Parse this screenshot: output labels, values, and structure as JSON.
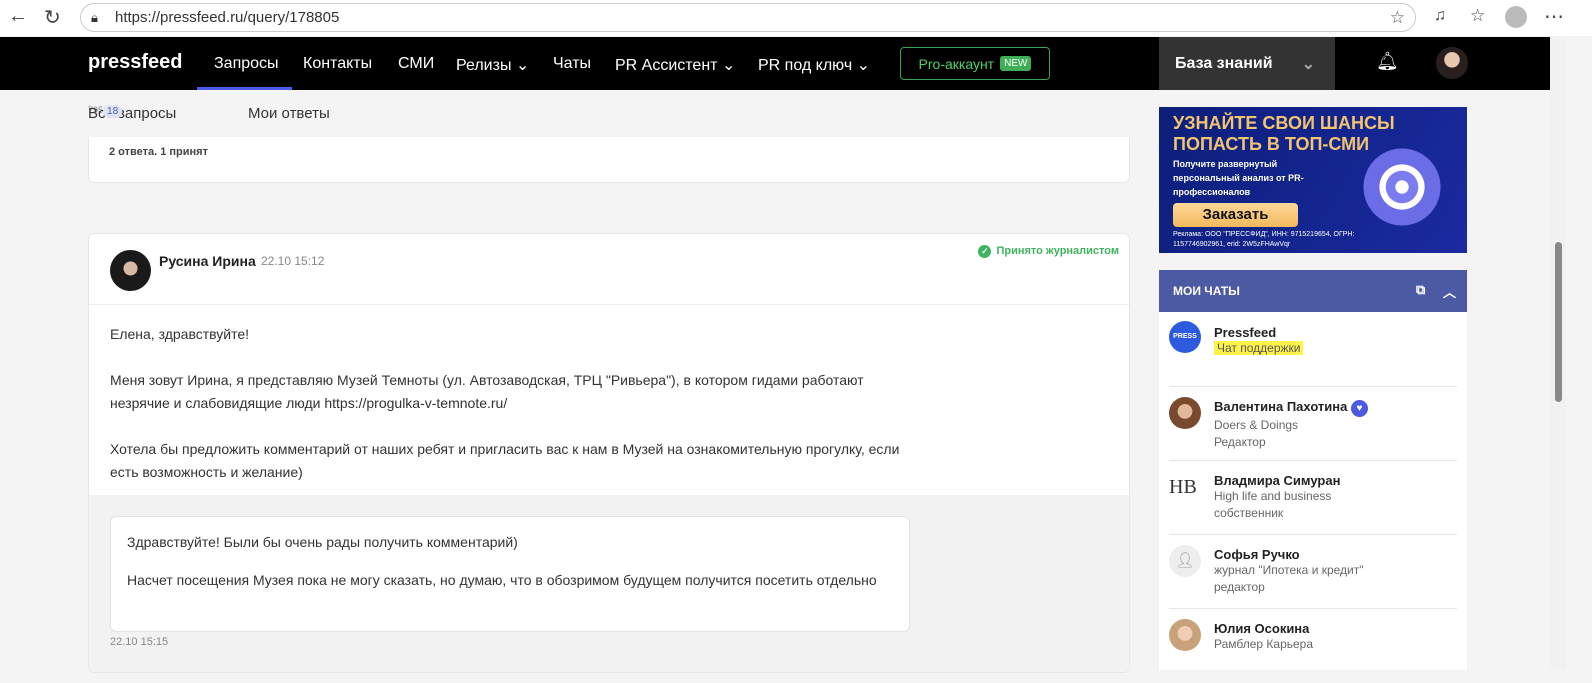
{
  "browser": {
    "url": "https://pressfeed.ru/query/178805"
  },
  "nav": {
    "logo": "pressfeed",
    "items": [
      "Запросы",
      "Контакты",
      "СМИ",
      "Релизы",
      "Чаты",
      "PR Ассистент",
      "PR под ключ"
    ],
    "pro": "Pro-аккаунт",
    "new_badge": "NEW",
    "knowledge": "База знаний"
  },
  "subtabs": {
    "all": "Все запросы",
    "all_count": "795",
    "new_count": "18",
    "mine": "Мои ответы"
  },
  "prev_card": {
    "status": "2 ответа. 1 принят"
  },
  "answer": {
    "author": "Русина Ирина",
    "time": "22.10 15:12",
    "status": "Принято журналистом",
    "paragraphs": [
      "Елена, здравствуйте!",
      "Меня зовут Ирина, я представляю Музей Темноты (ул. Автозаводская, ТРЦ \"Ривьера\"), в котором гидами работают незрячие и слабовидящие люди https://progulka-v-temnote.ru/",
      "Хотела бы предложить комментарий от наших ребят и пригласить вас к нам в Музей на ознакомительную прогулку, если есть возможность и желание)"
    ],
    "reply": [
      "Здравствуйте! Были бы очень рады получить комментарий)",
      "Насчет посещения Музея пока не могу сказать, но думаю, что в обозримом будущем получится посетить отдельно"
    ],
    "reply_time": "22.10 15:15"
  },
  "ad": {
    "headline": "УЗНАЙТЕ СВОИ ШАНСЫ ПОПАСТЬ В ТОП-СМИ",
    "sub": "Получите развернутый персональный анализ от PR-профессионалов",
    "button": "Заказать",
    "legal": "Реклама: ООО \"ПРЕССФИД\", ИНН: 9715219654, ОГРН: 1157746902961, erid: 2W5zFHAwVqr"
  },
  "chats": {
    "title": "МОИ ЧАТЫ",
    "items": [
      {
        "name": "Pressfeed",
        "lines": [
          "Чат поддержки"
        ]
      },
      {
        "name": "Валентина Пахотина",
        "lines": [
          "Doers & Doings",
          "Редактор"
        ]
      },
      {
        "name": "Владмира Симуран",
        "lines": [
          "High life and business",
          "собственник"
        ]
      },
      {
        "name": "Софья Ручко",
        "lines": [
          "журнал \"Ипотека и кредит\"",
          "редактор"
        ]
      },
      {
        "name": "Юлия Осокина",
        "lines": [
          "Рамблер Карьера"
        ]
      }
    ]
  }
}
